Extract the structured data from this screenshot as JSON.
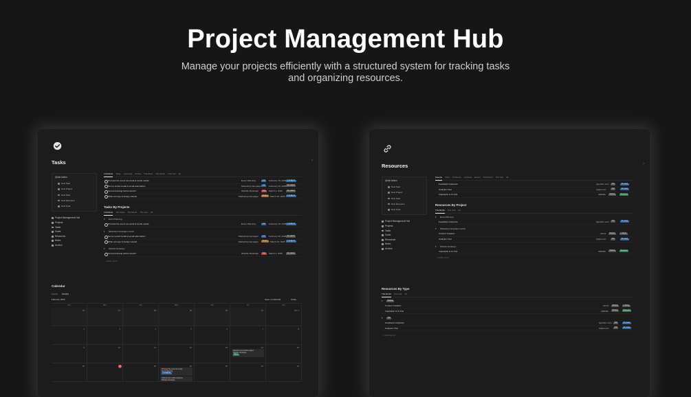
{
  "hero": {
    "title": "Project Management Hub",
    "subtitle": "Manage your projects efficiently with a structured system for tracking tasks and organizing resources."
  },
  "colors": {
    "background": "#161616",
    "panel": "#1c1c1c",
    "blue": "#2f6fb3",
    "green": "#2f8f5b",
    "orange": "#b7702a",
    "red": "#c0473f",
    "gray": "#5a5a5a"
  },
  "tasks_panel": {
    "icon": "check-circle-icon",
    "title": "Tasks",
    "collapse": "⌃",
    "sidebar": {
      "quick_action": "Quick Action",
      "actions": [
        "New Task",
        "New Project",
        "New Note",
        "New Resource",
        "New Goal"
      ],
      "nav": [
        "Project Management Hub",
        "Projects",
        "Tasks",
        "Goals",
        "Resources",
        "Notes",
        "Archive"
      ]
    },
    "tabs": [
      "Unfinished",
      "Today",
      "Upcoming",
      "Priority",
      "This Week",
      "This Month",
      "This Year",
      "All"
    ],
    "rows": [
      {
        "name": "Promote the event via email & social media",
        "project": "Event Planning",
        "tag": "Low",
        "date": "February 19, 2025",
        "status": "In progress"
      },
      {
        "name": "Set up social media & email automation",
        "project": "Marketing Campaign",
        "tag": "Low",
        "date": "February 20, 2025",
        "status": "Not started"
      },
      {
        "name": "Test and debug before launch",
        "project": "Website Redesign",
        "tag": "High",
        "date": "March 1, 2025",
        "status": "Not started"
      },
      {
        "name": "Write ad copy & design visuals",
        "project": "Marketing Campaign",
        "tag": "Medium",
        "date": "March 10, 2025",
        "status": "In progress"
      }
    ],
    "by_projects": {
      "title": "Tasks By Projects",
      "tabs": [
        "Unfinished",
        "This Week",
        "This Month",
        "This Year",
        "All"
      ],
      "groups": [
        {
          "name": "Event Planning",
          "rows": [
            {
              "name": "Promote the event via email & social media",
              "project": "Event Planning",
              "tag": "Low",
              "date": "February 19, 2025",
              "status": "In progress"
            }
          ]
        },
        {
          "name": "Marketing Campaign Launch",
          "rows": [
            {
              "name": "Set up social media & email automation",
              "project": "Marketing Campaign",
              "tag": "Low",
              "date": "February 20, 2025",
              "status": "Not started"
            },
            {
              "name": "Write ad copy & design visuals",
              "project": "Marketing Campaign",
              "tag": "Medium",
              "date": "March 10, 2025",
              "status": "In progress"
            }
          ]
        },
        {
          "name": "Website Redesign",
          "rows": [
            {
              "name": "Test and debug before launch",
              "project": "Website Redesign",
              "tag": "High",
              "date": "March 1, 2025",
              "status": "Not started"
            }
          ]
        }
      ],
      "new_group": "+ Hidden group"
    },
    "calendar": {
      "title": "Calendar",
      "tabs": [
        "Weekly",
        "Monthly"
      ],
      "month": "February 2025",
      "open_label": "Open in Calendar",
      "today_label": "Today",
      "weekdays": [
        "Sun",
        "Mon",
        "Tue",
        "Wed",
        "Thu",
        "Fri",
        "Sat"
      ],
      "week1": [
        "26",
        "27",
        "28",
        "29",
        "30",
        "31",
        "Feb 1"
      ],
      "week2": [
        "2",
        "3",
        "4",
        "5",
        "6",
        "7",
        "8"
      ],
      "week3": [
        "9",
        "10",
        "11",
        "12",
        "13",
        "14",
        "15"
      ],
      "week4": [
        "16",
        "17",
        "18",
        "19",
        "20",
        "21",
        "22"
      ],
      "events": {
        "e1": "Develop new website pages",
        "e1b": "Website Redesign",
        "e1c": "Done",
        "e2": "Promote the event via email...",
        "e2b": "Event Planning",
        "e2c": "In progress",
        "e3": "Optimize for mobile responsi...",
        "e3b": "Website Redesign"
      }
    }
  },
  "resources_panel": {
    "icon": "link-icon",
    "title": "Resources",
    "collapse": "⌃",
    "sidebar": {
      "quick_action": "Quick Action",
      "actions": [
        "New Task",
        "New Project",
        "New Note",
        "New Resource",
        "New Goal"
      ],
      "nav": [
        "Project Management Hub",
        "Projects",
        "Tasks",
        "Goals",
        "Resources",
        "Notes",
        "Archive"
      ]
    },
    "tabs": [
      "Favorite",
      "Inbox",
      "To Review",
      "Archived",
      "Recent",
      "This Month",
      "This Year",
      "All"
    ],
    "rows": [
      {
        "name": "Feedback Collection",
        "source": "typeform.com",
        "type": "Tool",
        "status": "To review"
      },
      {
        "name": "Analytics Tool",
        "source": "hotjar.com",
        "type": "Tool",
        "status": "To review"
      },
      {
        "name": "Inspiration & UI Kits",
        "source": "dribbble",
        "type": "Website",
        "status": "Reviewed"
      }
    ],
    "by_project": {
      "title": "Resources By Project",
      "tabs": [
        "This Month",
        "This Year",
        "All"
      ],
      "groups": [
        {
          "name": "Event Planning",
          "rows": [
            {
              "name": "Feedback Collection",
              "source": "typeform.com",
              "type": "Tool",
              "status": "To review"
            }
          ]
        },
        {
          "name": "Marketing Campaign Launch",
          "rows": [
            {
              "name": "Content Creation",
              "source": "canva",
              "type": "Website",
              "status": "In library"
            },
            {
              "name": "Analytics Tool",
              "source": "hotjar.com",
              "type": "Tool",
              "status": "To review"
            }
          ]
        },
        {
          "name": "Website Redesign",
          "rows": [
            {
              "name": "Inspiration & UI Kits",
              "source": "dribbble",
              "type": "Website",
              "status": "Reviewed"
            }
          ]
        }
      ],
      "new_group": "+ Hidden group"
    },
    "by_type": {
      "title": "Resources By Type",
      "tabs": [
        "This Month",
        "This Year",
        "All"
      ],
      "groups": [
        {
          "name": "Website",
          "rows": [
            {
              "name": "Content Creation",
              "source": "canva",
              "type": "Website",
              "status": "In library"
            },
            {
              "name": "Inspiration & UI Kits",
              "source": "dribbble",
              "type": "Website",
              "status": "Reviewed"
            }
          ]
        },
        {
          "name": "Tool",
          "rows": [
            {
              "name": "Feedback Collection",
              "source": "typeform.com",
              "type": "Tool",
              "status": "To review"
            },
            {
              "name": "Analytics Tool",
              "source": "hotjar.com",
              "type": "Tool",
              "status": "To review"
            }
          ]
        }
      ],
      "new_group": "+ Hidden group"
    }
  }
}
